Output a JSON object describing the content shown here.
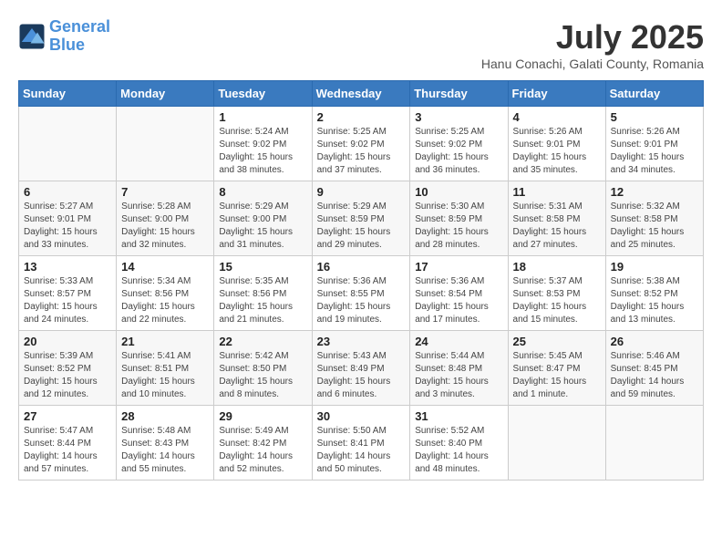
{
  "header": {
    "logo_line1": "General",
    "logo_line2": "Blue",
    "month_title": "July 2025",
    "location": "Hanu Conachi, Galati County, Romania"
  },
  "weekdays": [
    "Sunday",
    "Monday",
    "Tuesday",
    "Wednesday",
    "Thursday",
    "Friday",
    "Saturday"
  ],
  "weeks": [
    [
      {
        "day": "",
        "info": ""
      },
      {
        "day": "",
        "info": ""
      },
      {
        "day": "1",
        "info": "Sunrise: 5:24 AM\nSunset: 9:02 PM\nDaylight: 15 hours and 38 minutes."
      },
      {
        "day": "2",
        "info": "Sunrise: 5:25 AM\nSunset: 9:02 PM\nDaylight: 15 hours and 37 minutes."
      },
      {
        "day": "3",
        "info": "Sunrise: 5:25 AM\nSunset: 9:02 PM\nDaylight: 15 hours and 36 minutes."
      },
      {
        "day": "4",
        "info": "Sunrise: 5:26 AM\nSunset: 9:01 PM\nDaylight: 15 hours and 35 minutes."
      },
      {
        "day": "5",
        "info": "Sunrise: 5:26 AM\nSunset: 9:01 PM\nDaylight: 15 hours and 34 minutes."
      }
    ],
    [
      {
        "day": "6",
        "info": "Sunrise: 5:27 AM\nSunset: 9:01 PM\nDaylight: 15 hours and 33 minutes."
      },
      {
        "day": "7",
        "info": "Sunrise: 5:28 AM\nSunset: 9:00 PM\nDaylight: 15 hours and 32 minutes."
      },
      {
        "day": "8",
        "info": "Sunrise: 5:29 AM\nSunset: 9:00 PM\nDaylight: 15 hours and 31 minutes."
      },
      {
        "day": "9",
        "info": "Sunrise: 5:29 AM\nSunset: 8:59 PM\nDaylight: 15 hours and 29 minutes."
      },
      {
        "day": "10",
        "info": "Sunrise: 5:30 AM\nSunset: 8:59 PM\nDaylight: 15 hours and 28 minutes."
      },
      {
        "day": "11",
        "info": "Sunrise: 5:31 AM\nSunset: 8:58 PM\nDaylight: 15 hours and 27 minutes."
      },
      {
        "day": "12",
        "info": "Sunrise: 5:32 AM\nSunset: 8:58 PM\nDaylight: 15 hours and 25 minutes."
      }
    ],
    [
      {
        "day": "13",
        "info": "Sunrise: 5:33 AM\nSunset: 8:57 PM\nDaylight: 15 hours and 24 minutes."
      },
      {
        "day": "14",
        "info": "Sunrise: 5:34 AM\nSunset: 8:56 PM\nDaylight: 15 hours and 22 minutes."
      },
      {
        "day": "15",
        "info": "Sunrise: 5:35 AM\nSunset: 8:56 PM\nDaylight: 15 hours and 21 minutes."
      },
      {
        "day": "16",
        "info": "Sunrise: 5:36 AM\nSunset: 8:55 PM\nDaylight: 15 hours and 19 minutes."
      },
      {
        "day": "17",
        "info": "Sunrise: 5:36 AM\nSunset: 8:54 PM\nDaylight: 15 hours and 17 minutes."
      },
      {
        "day": "18",
        "info": "Sunrise: 5:37 AM\nSunset: 8:53 PM\nDaylight: 15 hours and 15 minutes."
      },
      {
        "day": "19",
        "info": "Sunrise: 5:38 AM\nSunset: 8:52 PM\nDaylight: 15 hours and 13 minutes."
      }
    ],
    [
      {
        "day": "20",
        "info": "Sunrise: 5:39 AM\nSunset: 8:52 PM\nDaylight: 15 hours and 12 minutes."
      },
      {
        "day": "21",
        "info": "Sunrise: 5:41 AM\nSunset: 8:51 PM\nDaylight: 15 hours and 10 minutes."
      },
      {
        "day": "22",
        "info": "Sunrise: 5:42 AM\nSunset: 8:50 PM\nDaylight: 15 hours and 8 minutes."
      },
      {
        "day": "23",
        "info": "Sunrise: 5:43 AM\nSunset: 8:49 PM\nDaylight: 15 hours and 6 minutes."
      },
      {
        "day": "24",
        "info": "Sunrise: 5:44 AM\nSunset: 8:48 PM\nDaylight: 15 hours and 3 minutes."
      },
      {
        "day": "25",
        "info": "Sunrise: 5:45 AM\nSunset: 8:47 PM\nDaylight: 15 hours and 1 minute."
      },
      {
        "day": "26",
        "info": "Sunrise: 5:46 AM\nSunset: 8:45 PM\nDaylight: 14 hours and 59 minutes."
      }
    ],
    [
      {
        "day": "27",
        "info": "Sunrise: 5:47 AM\nSunset: 8:44 PM\nDaylight: 14 hours and 57 minutes."
      },
      {
        "day": "28",
        "info": "Sunrise: 5:48 AM\nSunset: 8:43 PM\nDaylight: 14 hours and 55 minutes."
      },
      {
        "day": "29",
        "info": "Sunrise: 5:49 AM\nSunset: 8:42 PM\nDaylight: 14 hours and 52 minutes."
      },
      {
        "day": "30",
        "info": "Sunrise: 5:50 AM\nSunset: 8:41 PM\nDaylight: 14 hours and 50 minutes."
      },
      {
        "day": "31",
        "info": "Sunrise: 5:52 AM\nSunset: 8:40 PM\nDaylight: 14 hours and 48 minutes."
      },
      {
        "day": "",
        "info": ""
      },
      {
        "day": "",
        "info": ""
      }
    ]
  ]
}
